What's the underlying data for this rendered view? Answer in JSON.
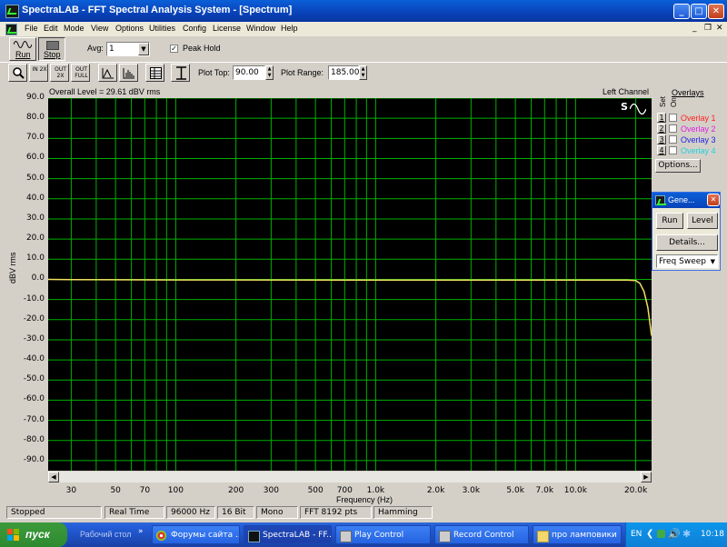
{
  "window": {
    "title": "SpectraLAB - FFT Spectral Analysis System - [Spectrum]",
    "controls": {
      "minimize": "_",
      "maximize": "□",
      "close": "✕"
    },
    "mdi_controls": {
      "minimize": "_",
      "restore": "❐",
      "close": "✕"
    }
  },
  "menu": [
    "File",
    "Edit",
    "Mode",
    "View",
    "Options",
    "Utilities",
    "Config",
    "License",
    "Window",
    "Help"
  ],
  "toolbar": {
    "run_label": "Run",
    "stop_label": "Stop",
    "avg_label": "Avg:",
    "avg_value": "1",
    "peak_hold_label": "Peak Hold",
    "peak_hold_checked": true,
    "zoom_buttons": [
      "IN 2X",
      "OUT 2X",
      "OUT FULL"
    ],
    "plot_top_label": "Plot Top:",
    "plot_top_value": "90.00",
    "plot_range_label": "Plot Range:",
    "plot_range_value": "185.00"
  },
  "plot": {
    "overall_level": "Overall Level = 29.61 dBV rms",
    "channel": "Left Channel",
    "ylabel": "dBV rms",
    "xlabel": "Frequency (Hz)",
    "grid_color": "#00b000",
    "trace_color": "#f0e060",
    "background": "#000000"
  },
  "chart_data": {
    "type": "line",
    "xlabel": "Frequency (Hz)",
    "ylabel": "dBV rms",
    "x_scale": "log",
    "xlim": [
      23,
      24000
    ],
    "ylim": [
      -95,
      90
    ],
    "grid": true,
    "y_ticks": [
      "90.0",
      "80.0",
      "70.0",
      "60.0",
      "50.0",
      "40.0",
      "30.0",
      "20.0",
      "10.0",
      "0.0",
      "-10.0",
      "-20.0",
      "-30.0",
      "-40.0",
      "-50.0",
      "-60.0",
      "-70.0",
      "-80.0",
      "-90.0"
    ],
    "x_ticks": [
      {
        "label": "30",
        "value": 30
      },
      {
        "label": "50",
        "value": 50
      },
      {
        "label": "70",
        "value": 70
      },
      {
        "label": "100",
        "value": 100
      },
      {
        "label": "200",
        "value": 200
      },
      {
        "label": "300",
        "value": 300
      },
      {
        "label": "500",
        "value": 500
      },
      {
        "label": "700",
        "value": 700
      },
      {
        "label": "1.0k",
        "value": 1000
      },
      {
        "label": "2.0k",
        "value": 2000
      },
      {
        "label": "3.0k",
        "value": 3000
      },
      {
        "label": "5.0k",
        "value": 5000
      },
      {
        "label": "7.0k",
        "value": 7000
      },
      {
        "label": "10.0k",
        "value": 10000
      },
      {
        "label": "20.0k",
        "value": 20000
      }
    ],
    "series": [
      {
        "x": [
          23,
          30,
          100,
          1000,
          10000,
          18000,
          20000,
          21000,
          22000,
          23000,
          24000
        ],
        "y": [
          0.0,
          -0.1,
          -0.3,
          -0.4,
          -0.4,
          -0.4,
          -0.6,
          -2.0,
          -6.0,
          -14.0,
          -28.0
        ]
      }
    ]
  },
  "overlays_panel": {
    "title": "Overlays",
    "set_label": "Set",
    "on_label": "On",
    "items": [
      {
        "num": "1",
        "label": "Overlay 1",
        "color": "#ff2020"
      },
      {
        "num": "2",
        "label": "Overlay 2",
        "color": "#e020e0"
      },
      {
        "num": "3",
        "label": "Overlay 3",
        "color": "#2020e0"
      },
      {
        "num": "4",
        "label": "Overlay 4",
        "color": "#20d0e0"
      }
    ],
    "options_label": "Options..."
  },
  "generator": {
    "title": "Gene...",
    "run_label": "Run",
    "level_label": "Level",
    "details_label": "Details...",
    "mode_value": "Freq Sweep"
  },
  "status_bar": [
    "Stopped",
    "Real Time",
    "96000 Hz",
    "16 Bit",
    "Mono",
    "FFT 8192 pts",
    "Hamming"
  ],
  "taskbar": {
    "start_label": "пуск",
    "desktop_label": "Рабочий стол",
    "tasks": [
      "Форумы сайта ...",
      "SpectraLAB - FF...",
      "Play Control",
      "Record Control",
      "про ламповики"
    ],
    "lang": "EN",
    "clock": "10:18"
  }
}
